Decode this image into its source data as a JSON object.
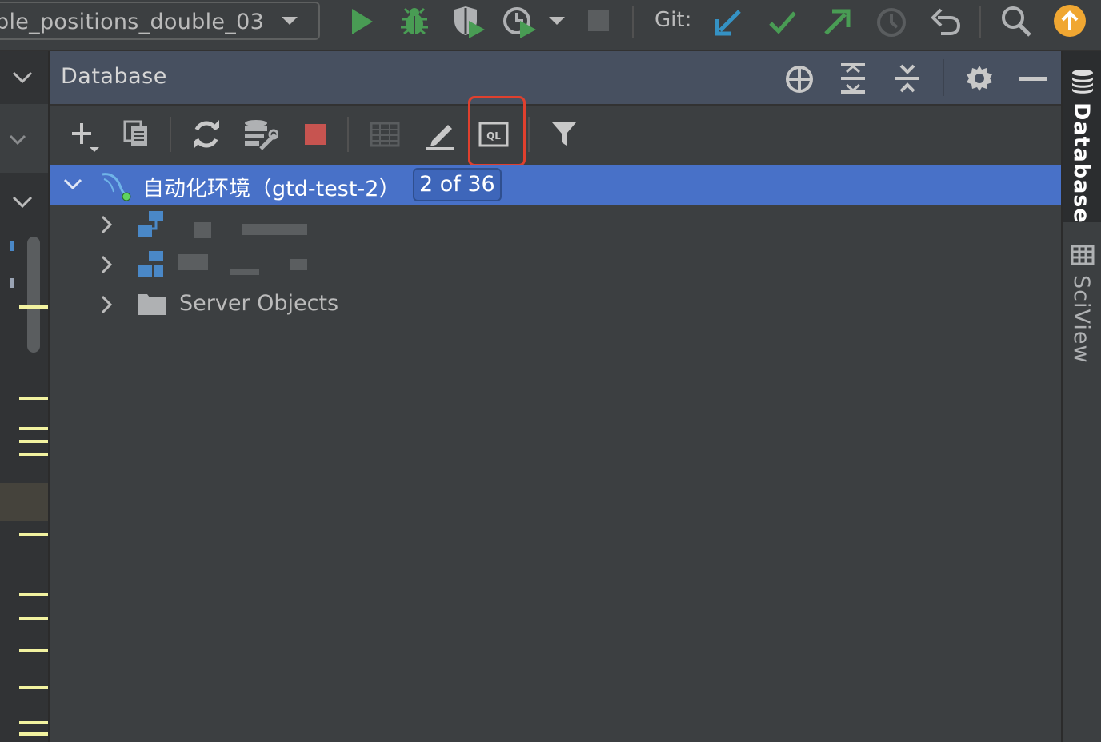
{
  "toolbar": {
    "run_config": "ble_positions_double_03",
    "git_label": "Git:",
    "icons": [
      "dropdown-arrow-icon",
      "run-icon",
      "debug-icon",
      "coverage-icon",
      "profile-icon",
      "dropdown-arrow-icon",
      "stop-icon",
      "git-update-icon",
      "git-commit-icon",
      "git-push-icon",
      "git-history-icon",
      "undo-icon",
      "search-icon",
      "update-available-icon"
    ]
  },
  "panel": {
    "title": "Database",
    "header_icons": [
      "locate-icon",
      "expand-all-icon",
      "collapse-all-icon",
      "settings-icon",
      "minimize-icon"
    ],
    "toolbar_icons": [
      "add-icon",
      "duplicate-icon",
      "refresh-icon",
      "schema-tools-icon",
      "stop-icon",
      "table-view-icon",
      "edit-icon",
      "query-console-icon",
      "filter-icon"
    ]
  },
  "tree": {
    "root": {
      "label": "自动化环境（gtd-test-2）",
      "badge": "2 of 36"
    },
    "children": [
      {
        "label": "",
        "icon": "schema-icon"
      },
      {
        "label": "",
        "icon": "schema-icon"
      },
      {
        "label": "Server Objects",
        "icon": "folder-icon"
      }
    ]
  },
  "right_tabs": [
    {
      "label": "Database",
      "icon": "database-icon"
    },
    {
      "label": "SciView",
      "icon": "sciview-icon"
    }
  ],
  "colors": {
    "selection": "#4871c8",
    "highlight_box": "#e0402e",
    "run_green": "#499c54",
    "accent_orange": "#f0a732",
    "git_blue": "#3592c4"
  }
}
